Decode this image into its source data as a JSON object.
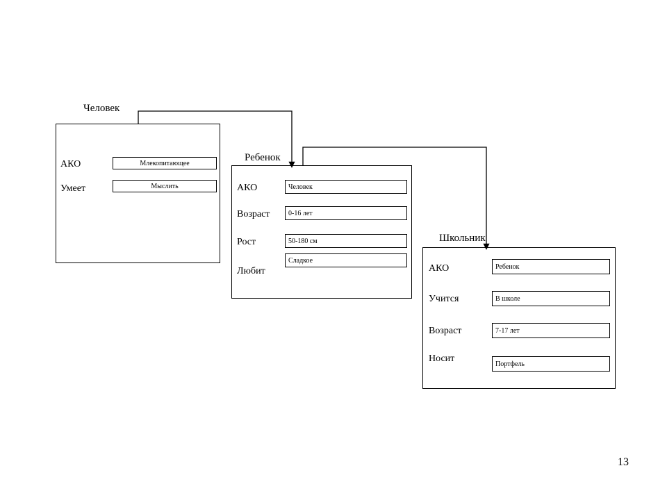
{
  "page_number": "13",
  "frames": {
    "human": {
      "title": "Человек",
      "slots": {
        "ako": {
          "label": "АКО",
          "value": "Млекопитающее"
        },
        "can": {
          "label": "Умеет",
          "value": "Мыслить"
        }
      }
    },
    "child": {
      "title": "Ребенок",
      "slots": {
        "ako": {
          "label": "АКО",
          "value": "Человек"
        },
        "age": {
          "label": "Возраст",
          "value": "0-16 лет"
        },
        "height": {
          "label": "Рост",
          "value": "50-180 см"
        },
        "likes": {
          "label": "Любит",
          "value": "Сладкое"
        }
      }
    },
    "pupil": {
      "title": "Школьник",
      "slots": {
        "ako": {
          "label": "АКО",
          "value": "Ребенок"
        },
        "studies": {
          "label": "Учится",
          "value": "В школе"
        },
        "age": {
          "label": "Возраст",
          "value": "7-17 лет"
        },
        "wears": {
          "label": "Носит",
          "value": "Портфель"
        }
      }
    }
  }
}
